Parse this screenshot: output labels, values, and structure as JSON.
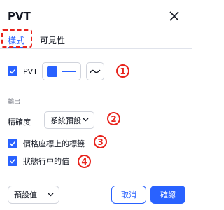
{
  "dialog": {
    "title": "PVT"
  },
  "tabs": [
    {
      "label": "樣式",
      "active": true
    },
    {
      "label": "可見性",
      "active": false
    }
  ],
  "style": {
    "pvt_label": "PVT",
    "pvt_checked": true,
    "plot_color": "#2962ff"
  },
  "output": {
    "section_label": "輸出",
    "precision_label": "精確度",
    "precision_value": "系統預設",
    "price_scale_label": "價格座標上的標籤",
    "price_scale_checked": true,
    "status_line_label": "狀態行中的值",
    "status_line_checked": true
  },
  "annotations": [
    "1",
    "2",
    "3",
    "4"
  ],
  "footer": {
    "defaults_label": "預設值",
    "cancel_label": "取消",
    "ok_label": "確認"
  },
  "colors": {
    "accent": "#2962ff",
    "annotation": "#e8231c"
  }
}
